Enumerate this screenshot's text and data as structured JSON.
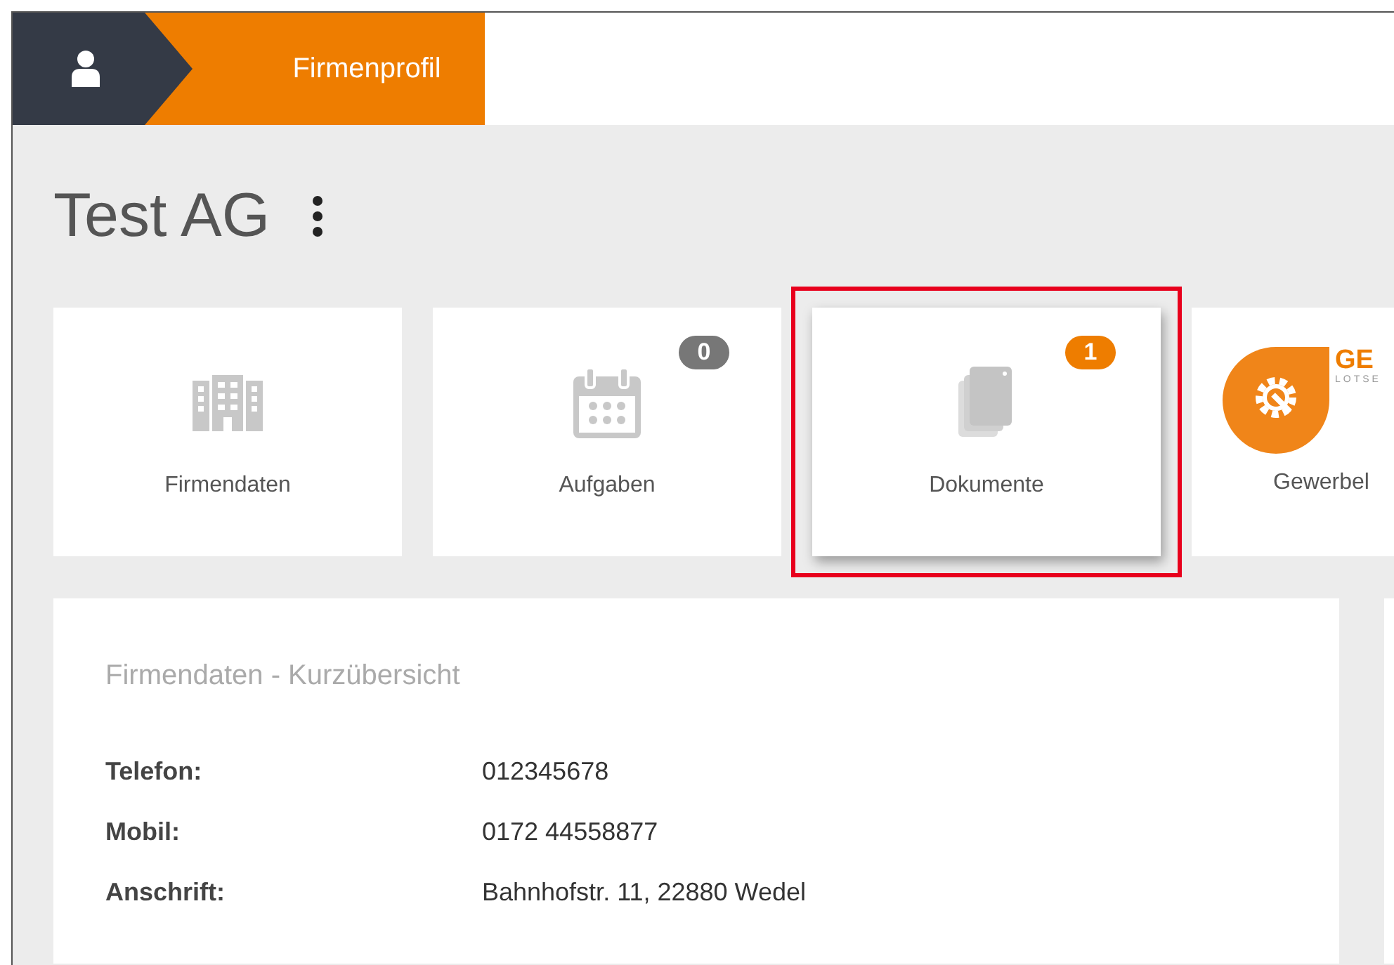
{
  "breadcrumb": {
    "current": "Firmenprofil"
  },
  "company": {
    "name": "Test AG"
  },
  "tiles": [
    {
      "kind": "building",
      "label": "Firmendaten",
      "highlighted": false
    },
    {
      "kind": "calendar",
      "label": "Aufgaben",
      "badge": {
        "text": "0",
        "color": "#777777"
      },
      "highlighted": false
    },
    {
      "kind": "documents",
      "label": "Dokumente",
      "badge": {
        "text": "1",
        "color": "#ee7d00"
      },
      "highlighted": true
    },
    {
      "kind": "logo",
      "label": "Gewerbel",
      "logo_title": "GE",
      "logo_subtitle": "LOTSE",
      "highlighted": false
    }
  ],
  "overview": {
    "title": "Firmendaten - Kurzübersicht",
    "rows": [
      {
        "label": "Telefon:",
        "value": "012345678"
      },
      {
        "label": "Mobil:",
        "value": "0172 44558877"
      },
      {
        "label": "Anschrift:",
        "value": "Bahnhofstr. 11, 22880 Wedel"
      }
    ]
  }
}
